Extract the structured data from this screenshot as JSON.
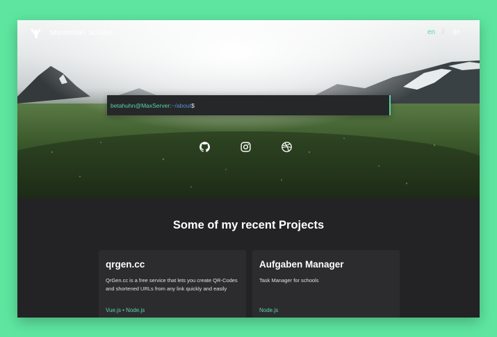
{
  "header": {
    "site_name": "Maximilian Schiller",
    "logo_icon": "logo-monogram-icon",
    "lang_en": "en",
    "lang_separator": "/",
    "lang_de": "de"
  },
  "terminal": {
    "user_host": "betahuhn@MaxServer:",
    "path": "~/about",
    "dollar": "$"
  },
  "socials": [
    {
      "icon": "github-icon"
    },
    {
      "icon": "instagram-icon"
    },
    {
      "icon": "dribbble-icon"
    }
  ],
  "projects": {
    "title": "Some of my recent Projects",
    "items": [
      {
        "title": "qrgen.cc",
        "description": "QrGen.cc is a free service that lets you create QR-Codes and shortened URLs from any link quickly and easily",
        "tags": "Vue.js • Node.js"
      },
      {
        "title": "Aufgaben Manager",
        "description": "Task Manager for schools",
        "tags": "Node.js"
      }
    ]
  },
  "colors": {
    "background": "#5ee6a0",
    "accent": "#57d6a8",
    "path_blue": "#5a8fd8",
    "page_dark": "#232325",
    "card": "#2c2c2e"
  }
}
